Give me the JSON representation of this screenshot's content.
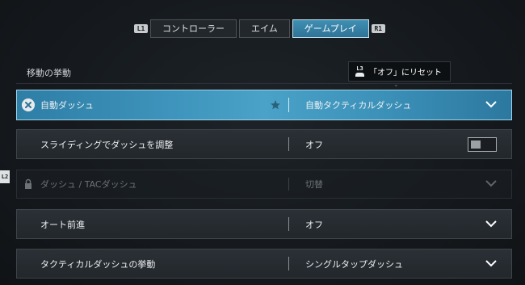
{
  "tabs": {
    "left_hint": "L1",
    "right_hint": "R1",
    "items": [
      {
        "label": "コントローラー"
      },
      {
        "label": "エイム"
      },
      {
        "label": "ゲームプレイ"
      }
    ],
    "active_index": 2
  },
  "section": {
    "title": "移動の挙動"
  },
  "tooltip": {
    "button_hint": "L3",
    "text": "「オフ」にリセット"
  },
  "side_hint": "L2",
  "settings": [
    {
      "label": "自動ダッシュ",
      "value": "自動タクティカルダッシュ",
      "control": "dropdown",
      "state": "selected",
      "icons": [
        "clear-icon",
        "star-icon",
        "chevron-down-icon"
      ]
    },
    {
      "label": "スライディングでダッシュを調整",
      "value": "オフ",
      "control": "toggle",
      "toggle_on": false
    },
    {
      "label": "ダッシュ / TACダッシュ",
      "value": "切替",
      "control": "dropdown",
      "state": "disabled",
      "icons": [
        "lock-icon",
        "chevron-down-icon"
      ]
    },
    {
      "label": "オート前進",
      "value": "オフ",
      "control": "dropdown"
    },
    {
      "label": "タクティカルダッシュの挙動",
      "value": "シングルタップダッシュ",
      "control": "dropdown"
    }
  ],
  "colors": {
    "accent": "#3d93bb",
    "accent_border": "#9fd3ea",
    "background": "#15191d",
    "row_bg": "#2a3035"
  }
}
